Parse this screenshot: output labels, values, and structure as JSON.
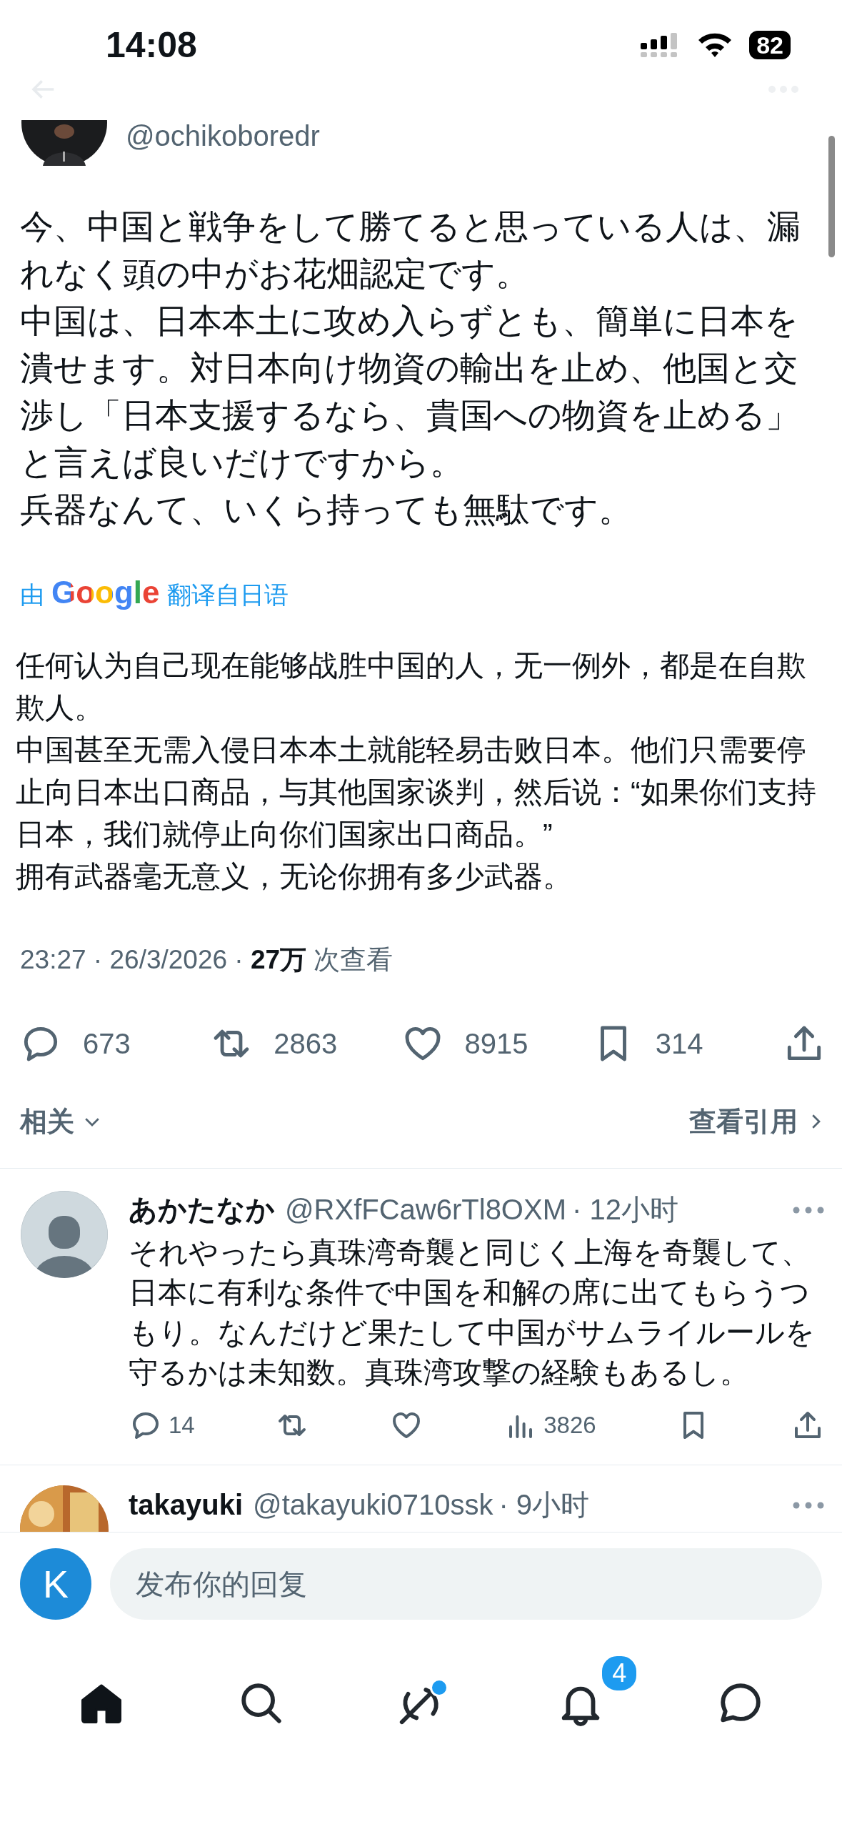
{
  "status_bar": {
    "time": "14:08",
    "battery": "82"
  },
  "post": {
    "handle": "@ochikoboredr",
    "paragraphs": [
      "今、中国と戦争をして勝てると思っている人は、漏れなく頭の中がお花畑認定です。",
      "中国は、日本本土に攻め入らずとも、簡単に日本を潰せます。対日本向け物資の輸出を止め、他国と交渉し「日本支援するなら、貴国への物資を止める」と言えば良いだけですから。",
      "兵器なんて、いくら持っても無駄です。"
    ],
    "translation": {
      "prefix": "由",
      "brand": "Google",
      "suffix": "翻译自日语"
    },
    "translated_paragraphs": [
      "任何认为自己现在能够战胜中国的人，无一例外，都是在自欺欺人。",
      "中国甚至无需入侵日本本土就能轻易击败日本。他们只需要停止向日本出口商品，与其他国家谈判，然后说：“如果你们支持日本，我们就停止向你们国家出口商品。”",
      "拥有武器毫无意义，无论你拥有多少武器。"
    ],
    "meta": "23:27 · 26/3/2026 · **27万** 次查看",
    "stats": [
      {
        "kind": "reply",
        "count": "673"
      },
      {
        "kind": "repost",
        "count": "2863"
      },
      {
        "kind": "like",
        "count": "8915"
      },
      {
        "kind": "bookmark",
        "count": "314"
      },
      {
        "kind": "share"
      }
    ]
  },
  "related": {
    "label": "相关",
    "quotes": "查看引用"
  },
  "replies": [
    {
      "avatar": {
        "kind": "default"
      },
      "name": "あかたなか",
      "handle": "@RXfFCaw6rTl8OXM",
      "time": "· 12小时",
      "text": "それやったら真珠湾奇襲と同じく上海を奇襲して、日本に有利な条件で中国を和解の席に出てもらうつもり。なんだけど果たして中国がサムライルールを守るかは未知数。真珠湾攻撃の経験もあるし。",
      "stats": [
        {
          "kind": "reply",
          "count": "14"
        },
        {
          "kind": "repost"
        },
        {
          "kind": "like"
        },
        {
          "kind": "views",
          "count": "3826"
        },
        {
          "kind": "bookmark"
        },
        {
          "kind": "share"
        }
      ]
    },
    {
      "name": "takayuki",
      "handle": "@takayuki0710ssk",
      "time": "· 9小时"
    }
  ],
  "composer": {
    "avatar": "K",
    "placeholder": "发布你的回复"
  },
  "nav": [
    {
      "kind": "home",
      "selected": true
    },
    {
      "kind": "search",
      "selected": false
    },
    {
      "kind": "grok",
      "selected": false,
      "dot": true
    },
    {
      "kind": "notifications",
      "selected": false,
      "badge": "4"
    },
    {
      "kind": "messages",
      "selected": false
    }
  ]
}
